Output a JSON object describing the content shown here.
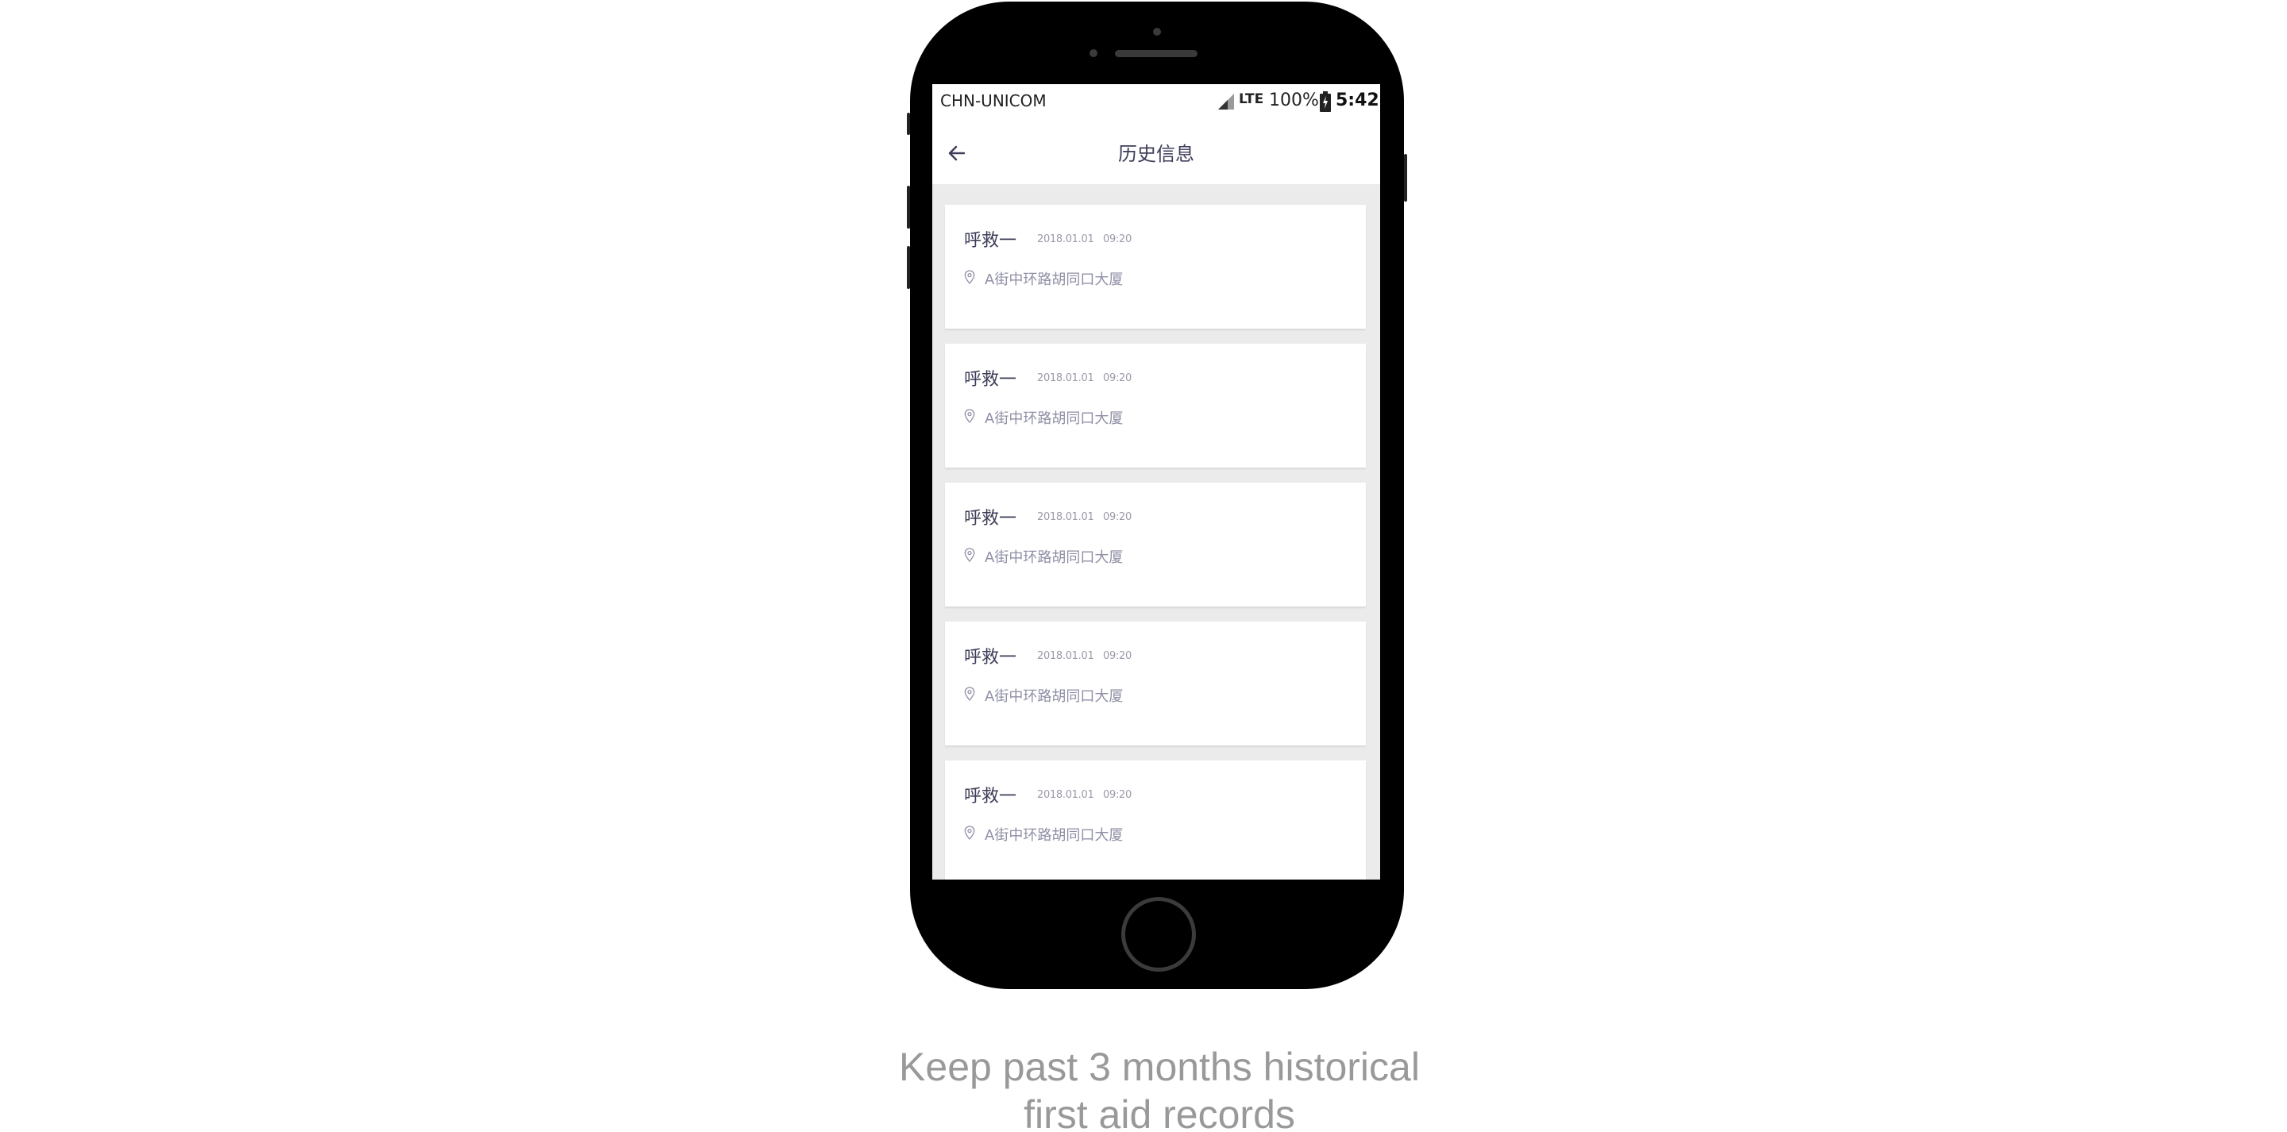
{
  "status_bar": {
    "carrier": "CHN-UNICOM",
    "network": "LTE",
    "battery": "100%",
    "time": "5:42"
  },
  "header": {
    "title": "历史信息",
    "back_icon": "arrow-left-icon"
  },
  "records": [
    {
      "title": "呼救一",
      "date": "2018.01.01",
      "time": "09:20",
      "address": "A街中环路胡同口大厦"
    },
    {
      "title": "呼救一",
      "date": "2018.01.01",
      "time": "09:20",
      "address": "A街中环路胡同口大厦"
    },
    {
      "title": "呼救一",
      "date": "2018.01.01",
      "time": "09:20",
      "address": "A街中环路胡同口大厦"
    },
    {
      "title": "呼救一",
      "date": "2018.01.01",
      "time": "09:20",
      "address": "A街中环路胡同口大厦"
    },
    {
      "title": "呼救一",
      "date": "2018.01.01",
      "time": "09:20",
      "address": "A街中环路胡同口大厦"
    }
  ],
  "caption": {
    "line1": "Keep past 3 months historical",
    "line2": "first aid records"
  },
  "colors": {
    "accent_text": "#3d3d58",
    "muted_text": "#9a9aaa",
    "list_background": "#ebebeb"
  }
}
